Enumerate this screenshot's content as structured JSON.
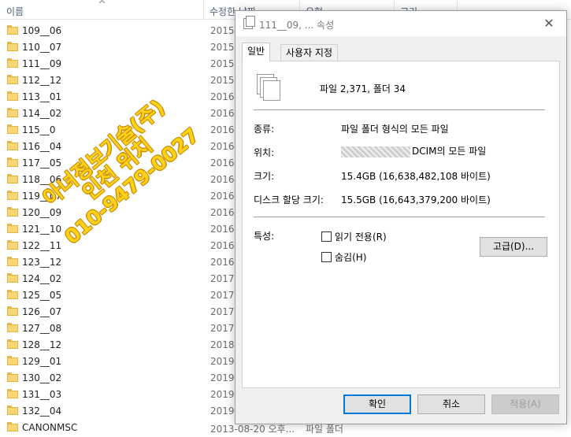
{
  "explorer": {
    "columns": {
      "name": "이름",
      "date": "수정한 날짜",
      "type": "유형",
      "size": "크기"
    },
    "rows": [
      {
        "name": "109__06",
        "date": "2015"
      },
      {
        "name": "110__07",
        "date": "2015"
      },
      {
        "name": "111__09",
        "date": "2015"
      },
      {
        "name": "112__12",
        "date": "2015"
      },
      {
        "name": "113__01",
        "date": "2016"
      },
      {
        "name": "114__02",
        "date": "2016"
      },
      {
        "name": "115__0",
        "date": "2016"
      },
      {
        "name": "116__04",
        "date": "2016"
      },
      {
        "name": "117__05",
        "date": "2016"
      },
      {
        "name": "118__06",
        "date": "2016"
      },
      {
        "name": "119__07",
        "date": "2016"
      },
      {
        "name": "120__09",
        "date": "2016"
      },
      {
        "name": "121__10",
        "date": "2016"
      },
      {
        "name": "122__11",
        "date": "2016"
      },
      {
        "name": "123__12",
        "date": "2016"
      },
      {
        "name": "124__02",
        "date": "2017"
      },
      {
        "name": "125__05",
        "date": "2017"
      },
      {
        "name": "126__07",
        "date": "2017"
      },
      {
        "name": "127__08",
        "date": "2017"
      },
      {
        "name": "128__12",
        "date": "2018"
      },
      {
        "name": "129__01",
        "date": "2019"
      },
      {
        "name": "130__02",
        "date": "2019"
      },
      {
        "name": "131__03",
        "date": "2019"
      },
      {
        "name": "132__04",
        "date": "2019"
      },
      {
        "name": "CANONMSC",
        "date": "2013-08-20 오후...",
        "type": "파일 폴더"
      }
    ]
  },
  "watermark": {
    "line1": "아녀정보기술(주)",
    "line2": "인천 위치",
    "line3": "010-9479-0027"
  },
  "dialog": {
    "title": "111__09, ... 속성",
    "close": "✕",
    "tabs": [
      {
        "label": "일반"
      },
      {
        "label": "사용자 지정"
      }
    ],
    "summary": "파일 2,371, 폴더 34",
    "props": {
      "type_label": "종류:",
      "type_value": "파일 폴더 형식의 모든 파일",
      "location_label": "위치:",
      "location_value": "DCIM의 모든 파일",
      "size_label": "크기:",
      "size_value": "15.4GB (16,638,482,108 바이트)",
      "disk_label": "디스크 할당 크기:",
      "disk_value": "15.5GB (16,643,379,200 바이트)",
      "attr_label": "특성:",
      "readonly_label": "읽기 전용(R)",
      "hidden_label": "숨김(H)",
      "advanced_label": "고급(D)..."
    },
    "buttons": {
      "ok": "확인",
      "cancel": "취소",
      "apply": "적용(A)"
    }
  }
}
